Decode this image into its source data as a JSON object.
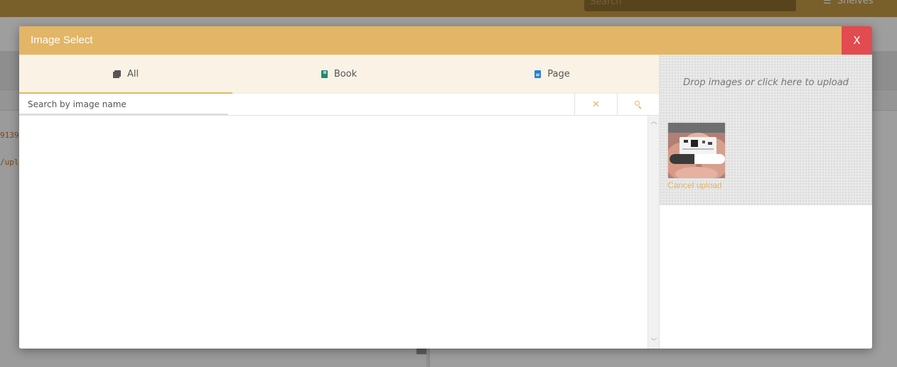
{
  "background": {
    "search_placeholder": "Search",
    "shelves_label": "Shelves",
    "code_line_1": "9139",
    "code_line_2": "/upl"
  },
  "modal": {
    "title": "Image Select",
    "close_label": "X",
    "tabs": [
      {
        "label": "All",
        "icon": "images-icon",
        "active": true
      },
      {
        "label": "Book",
        "icon": "book-icon",
        "active": false
      },
      {
        "label": "Page",
        "icon": "page-icon",
        "active": false
      }
    ],
    "search": {
      "placeholder": "Search by image name",
      "value": ""
    },
    "dropzone": {
      "text": "Drop images or click here to upload",
      "upload": {
        "progress": 0.45,
        "cancel_label": "Cancel upload"
      }
    }
  },
  "colors": {
    "accent": "#e3b566",
    "close": "#e24b4f",
    "tab_bar": "#f9f2e5",
    "book_icon": "#1f8a6f",
    "page_icon": "#2a7fd4"
  }
}
